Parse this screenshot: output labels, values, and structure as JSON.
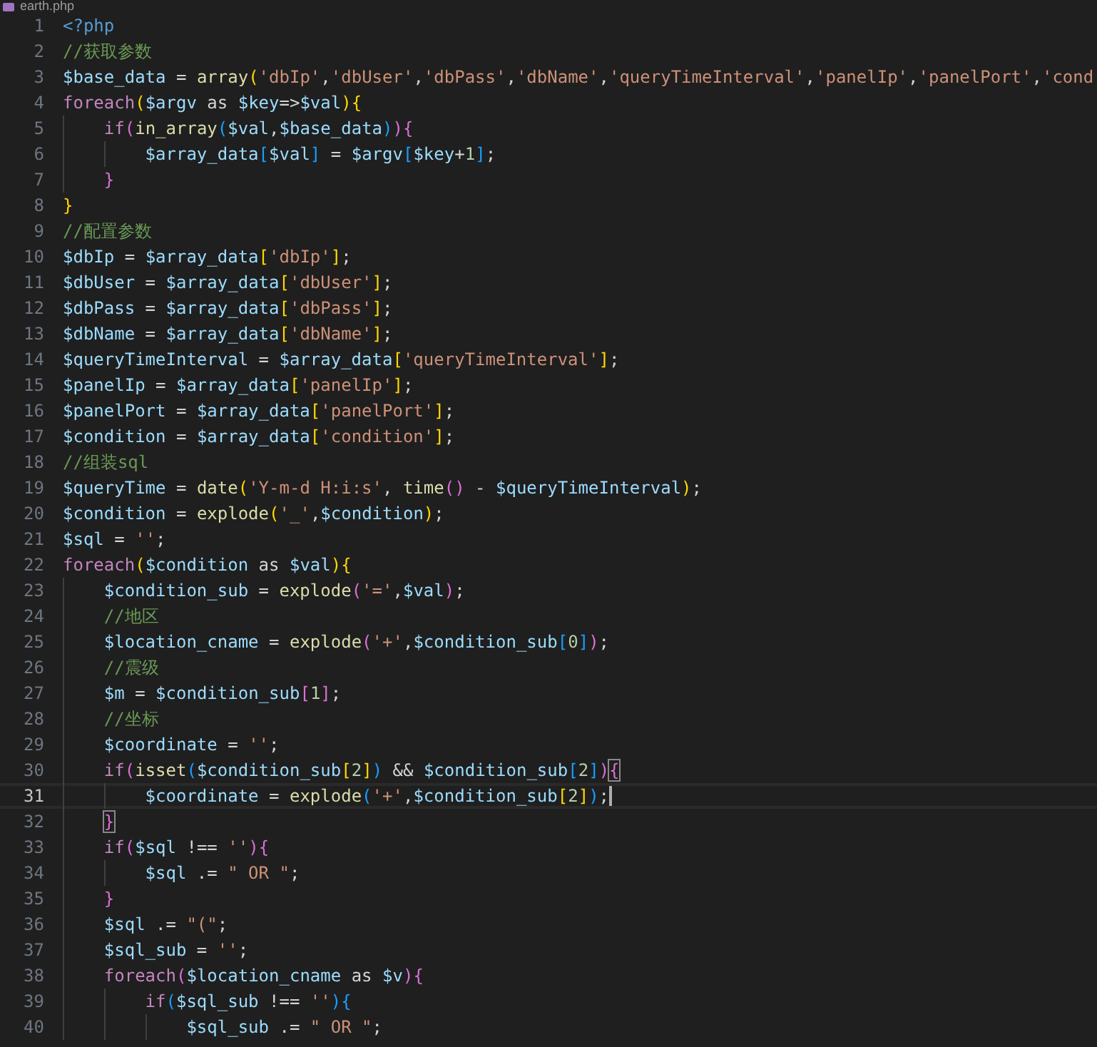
{
  "tab": {
    "title": "earth.php"
  },
  "lines": [
    {
      "number": "1",
      "current": false,
      "tokens": [
        {
          "kind": "tag",
          "text": "<?php"
        }
      ]
    },
    {
      "number": "2",
      "current": false,
      "tokens": [
        {
          "kind": "cm",
          "text": "//获取参数"
        }
      ]
    },
    {
      "number": "3",
      "current": false,
      "tokens": [
        {
          "kind": "var",
          "text": "$base_data"
        },
        {
          "kind": "op",
          "text": " = "
        },
        {
          "kind": "fn",
          "text": "array"
        },
        {
          "kind": "b1",
          "text": "("
        },
        {
          "kind": "str",
          "text": "'dbIp'"
        },
        {
          "kind": "op",
          "text": ","
        },
        {
          "kind": "str",
          "text": "'dbUser'"
        },
        {
          "kind": "op",
          "text": ","
        },
        {
          "kind": "str",
          "text": "'dbPass'"
        },
        {
          "kind": "op",
          "text": ","
        },
        {
          "kind": "str",
          "text": "'dbName'"
        },
        {
          "kind": "op",
          "text": ","
        },
        {
          "kind": "str",
          "text": "'queryTimeInterval'"
        },
        {
          "kind": "op",
          "text": ","
        },
        {
          "kind": "str",
          "text": "'panelIp'"
        },
        {
          "kind": "op",
          "text": ","
        },
        {
          "kind": "str",
          "text": "'panelPort'"
        },
        {
          "kind": "op",
          "text": ","
        },
        {
          "kind": "str",
          "text": "'cond"
        }
      ]
    },
    {
      "number": "4",
      "current": false,
      "tokens": [
        {
          "kind": "kw",
          "text": "foreach"
        },
        {
          "kind": "b1",
          "text": "("
        },
        {
          "kind": "var",
          "text": "$argv"
        },
        {
          "kind": "op",
          "text": " as "
        },
        {
          "kind": "var",
          "text": "$key"
        },
        {
          "kind": "op",
          "text": "=>"
        },
        {
          "kind": "var",
          "text": "$val"
        },
        {
          "kind": "b1",
          "text": ")"
        },
        {
          "kind": "b1",
          "text": "{"
        }
      ]
    },
    {
      "number": "5",
      "current": false,
      "tokens": [
        {
          "kind": "kw",
          "text": "    if"
        },
        {
          "kind": "b2",
          "text": "("
        },
        {
          "kind": "fn",
          "text": "in_array"
        },
        {
          "kind": "b3",
          "text": "("
        },
        {
          "kind": "var",
          "text": "$val"
        },
        {
          "kind": "op",
          "text": ","
        },
        {
          "kind": "var",
          "text": "$base_data"
        },
        {
          "kind": "b3",
          "text": ")"
        },
        {
          "kind": "b2",
          "text": ")"
        },
        {
          "kind": "b2",
          "text": "{"
        }
      ]
    },
    {
      "number": "6",
      "current": false,
      "tokens": [
        {
          "kind": "var",
          "text": "        $array_data"
        },
        {
          "kind": "b3",
          "text": "["
        },
        {
          "kind": "var",
          "text": "$val"
        },
        {
          "kind": "b3",
          "text": "]"
        },
        {
          "kind": "op",
          "text": " = "
        },
        {
          "kind": "var",
          "text": "$argv"
        },
        {
          "kind": "b3",
          "text": "["
        },
        {
          "kind": "var",
          "text": "$key"
        },
        {
          "kind": "op",
          "text": "+"
        },
        {
          "kind": "num",
          "text": "1"
        },
        {
          "kind": "b3",
          "text": "]"
        },
        {
          "kind": "op",
          "text": ";"
        }
      ]
    },
    {
      "number": "7",
      "current": false,
      "tokens": [
        {
          "kind": "b2",
          "text": "    }"
        }
      ]
    },
    {
      "number": "8",
      "current": false,
      "tokens": [
        {
          "kind": "b1",
          "text": "}"
        }
      ]
    },
    {
      "number": "9",
      "current": false,
      "tokens": [
        {
          "kind": "cm",
          "text": "//配置参数"
        }
      ]
    },
    {
      "number": "10",
      "current": false,
      "tokens": [
        {
          "kind": "var",
          "text": "$dbIp"
        },
        {
          "kind": "op",
          "text": " = "
        },
        {
          "kind": "var",
          "text": "$array_data"
        },
        {
          "kind": "b1",
          "text": "["
        },
        {
          "kind": "str",
          "text": "'dbIp'"
        },
        {
          "kind": "b1",
          "text": "]"
        },
        {
          "kind": "op",
          "text": ";"
        }
      ]
    },
    {
      "number": "11",
      "current": false,
      "tokens": [
        {
          "kind": "var",
          "text": "$dbUser"
        },
        {
          "kind": "op",
          "text": " = "
        },
        {
          "kind": "var",
          "text": "$array_data"
        },
        {
          "kind": "b1",
          "text": "["
        },
        {
          "kind": "str",
          "text": "'dbUser'"
        },
        {
          "kind": "b1",
          "text": "]"
        },
        {
          "kind": "op",
          "text": ";"
        }
      ]
    },
    {
      "number": "12",
      "current": false,
      "tokens": [
        {
          "kind": "var",
          "text": "$dbPass"
        },
        {
          "kind": "op",
          "text": " = "
        },
        {
          "kind": "var",
          "text": "$array_data"
        },
        {
          "kind": "b1",
          "text": "["
        },
        {
          "kind": "str",
          "text": "'dbPass'"
        },
        {
          "kind": "b1",
          "text": "]"
        },
        {
          "kind": "op",
          "text": ";"
        }
      ]
    },
    {
      "number": "13",
      "current": false,
      "tokens": [
        {
          "kind": "var",
          "text": "$dbName"
        },
        {
          "kind": "op",
          "text": " = "
        },
        {
          "kind": "var",
          "text": "$array_data"
        },
        {
          "kind": "b1",
          "text": "["
        },
        {
          "kind": "str",
          "text": "'dbName'"
        },
        {
          "kind": "b1",
          "text": "]"
        },
        {
          "kind": "op",
          "text": ";"
        }
      ]
    },
    {
      "number": "14",
      "current": false,
      "tokens": [
        {
          "kind": "var",
          "text": "$queryTimeInterval"
        },
        {
          "kind": "op",
          "text": " = "
        },
        {
          "kind": "var",
          "text": "$array_data"
        },
        {
          "kind": "b1",
          "text": "["
        },
        {
          "kind": "str",
          "text": "'queryTimeInterval'"
        },
        {
          "kind": "b1",
          "text": "]"
        },
        {
          "kind": "op",
          "text": ";"
        }
      ]
    },
    {
      "number": "15",
      "current": false,
      "tokens": [
        {
          "kind": "var",
          "text": "$panelIp"
        },
        {
          "kind": "op",
          "text": " = "
        },
        {
          "kind": "var",
          "text": "$array_data"
        },
        {
          "kind": "b1",
          "text": "["
        },
        {
          "kind": "str",
          "text": "'panelIp'"
        },
        {
          "kind": "b1",
          "text": "]"
        },
        {
          "kind": "op",
          "text": ";"
        }
      ]
    },
    {
      "number": "16",
      "current": false,
      "tokens": [
        {
          "kind": "var",
          "text": "$panelPort"
        },
        {
          "kind": "op",
          "text": " = "
        },
        {
          "kind": "var",
          "text": "$array_data"
        },
        {
          "kind": "b1",
          "text": "["
        },
        {
          "kind": "str",
          "text": "'panelPort'"
        },
        {
          "kind": "b1",
          "text": "]"
        },
        {
          "kind": "op",
          "text": ";"
        }
      ]
    },
    {
      "number": "17",
      "current": false,
      "tokens": [
        {
          "kind": "var",
          "text": "$condition"
        },
        {
          "kind": "op",
          "text": " = "
        },
        {
          "kind": "var",
          "text": "$array_data"
        },
        {
          "kind": "b1",
          "text": "["
        },
        {
          "kind": "str",
          "text": "'condition'"
        },
        {
          "kind": "b1",
          "text": "]"
        },
        {
          "kind": "op",
          "text": ";"
        }
      ]
    },
    {
      "number": "18",
      "current": false,
      "tokens": [
        {
          "kind": "cm",
          "text": "//组装sql"
        }
      ]
    },
    {
      "number": "19",
      "current": false,
      "tokens": [
        {
          "kind": "var",
          "text": "$queryTime"
        },
        {
          "kind": "op",
          "text": " = "
        },
        {
          "kind": "fn",
          "text": "date"
        },
        {
          "kind": "b1",
          "text": "("
        },
        {
          "kind": "str",
          "text": "'Y-m-d H:i:s'"
        },
        {
          "kind": "op",
          "text": ", "
        },
        {
          "kind": "fn",
          "text": "time"
        },
        {
          "kind": "b2",
          "text": "()"
        },
        {
          "kind": "op",
          "text": " - "
        },
        {
          "kind": "var",
          "text": "$queryTimeInterval"
        },
        {
          "kind": "b1",
          "text": ")"
        },
        {
          "kind": "op",
          "text": ";"
        }
      ]
    },
    {
      "number": "20",
      "current": false,
      "tokens": [
        {
          "kind": "var",
          "text": "$condition"
        },
        {
          "kind": "op",
          "text": " = "
        },
        {
          "kind": "fn",
          "text": "explode"
        },
        {
          "kind": "b1",
          "text": "("
        },
        {
          "kind": "str",
          "text": "'_'"
        },
        {
          "kind": "op",
          "text": ","
        },
        {
          "kind": "var",
          "text": "$condition"
        },
        {
          "kind": "b1",
          "text": ")"
        },
        {
          "kind": "op",
          "text": ";"
        }
      ]
    },
    {
      "number": "21",
      "current": false,
      "tokens": [
        {
          "kind": "var",
          "text": "$sql"
        },
        {
          "kind": "op",
          "text": " = "
        },
        {
          "kind": "str",
          "text": "''"
        },
        {
          "kind": "op",
          "text": ";"
        }
      ]
    },
    {
      "number": "22",
      "current": false,
      "tokens": [
        {
          "kind": "kw",
          "text": "foreach"
        },
        {
          "kind": "b1",
          "text": "("
        },
        {
          "kind": "var",
          "text": "$condition"
        },
        {
          "kind": "op",
          "text": " as "
        },
        {
          "kind": "var",
          "text": "$val"
        },
        {
          "kind": "b1",
          "text": ")"
        },
        {
          "kind": "b1",
          "text": "{"
        }
      ]
    },
    {
      "number": "23",
      "current": false,
      "tokens": [
        {
          "kind": "var",
          "text": "    $condition_sub"
        },
        {
          "kind": "op",
          "text": " = "
        },
        {
          "kind": "fn",
          "text": "explode"
        },
        {
          "kind": "b2",
          "text": "("
        },
        {
          "kind": "str",
          "text": "'='"
        },
        {
          "kind": "op",
          "text": ","
        },
        {
          "kind": "var",
          "text": "$val"
        },
        {
          "kind": "b2",
          "text": ")"
        },
        {
          "kind": "op",
          "text": ";"
        }
      ]
    },
    {
      "number": "24",
      "current": false,
      "tokens": [
        {
          "kind": "cm",
          "text": "    //地区"
        }
      ]
    },
    {
      "number": "25",
      "current": false,
      "tokens": [
        {
          "kind": "var",
          "text": "    $location_cname"
        },
        {
          "kind": "op",
          "text": " = "
        },
        {
          "kind": "fn",
          "text": "explode"
        },
        {
          "kind": "b2",
          "text": "("
        },
        {
          "kind": "str",
          "text": "'+'"
        },
        {
          "kind": "op",
          "text": ","
        },
        {
          "kind": "var",
          "text": "$condition_sub"
        },
        {
          "kind": "b3",
          "text": "["
        },
        {
          "kind": "num",
          "text": "0"
        },
        {
          "kind": "b3",
          "text": "]"
        },
        {
          "kind": "b2",
          "text": ")"
        },
        {
          "kind": "op",
          "text": ";"
        }
      ]
    },
    {
      "number": "26",
      "current": false,
      "tokens": [
        {
          "kind": "cm",
          "text": "    //震级"
        }
      ]
    },
    {
      "number": "27",
      "current": false,
      "tokens": [
        {
          "kind": "var",
          "text": "    $m"
        },
        {
          "kind": "op",
          "text": " = "
        },
        {
          "kind": "var",
          "text": "$condition_sub"
        },
        {
          "kind": "b2",
          "text": "["
        },
        {
          "kind": "num",
          "text": "1"
        },
        {
          "kind": "b2",
          "text": "]"
        },
        {
          "kind": "op",
          "text": ";"
        }
      ]
    },
    {
      "number": "28",
      "current": false,
      "tokens": [
        {
          "kind": "cm",
          "text": "    //坐标"
        }
      ]
    },
    {
      "number": "29",
      "current": false,
      "tokens": [
        {
          "kind": "var",
          "text": "    $coordinate"
        },
        {
          "kind": "op",
          "text": " = "
        },
        {
          "kind": "str",
          "text": "''"
        },
        {
          "kind": "op",
          "text": ";"
        }
      ]
    },
    {
      "number": "30",
      "current": false,
      "tokens": [
        {
          "kind": "kw",
          "text": "    if"
        },
        {
          "kind": "b2",
          "text": "("
        },
        {
          "kind": "fn",
          "text": "isset"
        },
        {
          "kind": "b3",
          "text": "("
        },
        {
          "kind": "var",
          "text": "$condition_sub"
        },
        {
          "kind": "b1",
          "text": "["
        },
        {
          "kind": "num",
          "text": "2"
        },
        {
          "kind": "b1",
          "text": "]"
        },
        {
          "kind": "b3",
          "text": ")"
        },
        {
          "kind": "op",
          "text": " && "
        },
        {
          "kind": "var",
          "text": "$condition_sub"
        },
        {
          "kind": "b3",
          "text": "["
        },
        {
          "kind": "num",
          "text": "2"
        },
        {
          "kind": "b3",
          "text": "]"
        },
        {
          "kind": "b2",
          "text": ")"
        },
        {
          "kind": "b2",
          "text": "{",
          "matched": true
        }
      ]
    },
    {
      "number": "31",
      "current": true,
      "tokens": [
        {
          "kind": "var",
          "text": "        $coordinate"
        },
        {
          "kind": "op",
          "text": " = "
        },
        {
          "kind": "fn",
          "text": "explode"
        },
        {
          "kind": "b3",
          "text": "("
        },
        {
          "kind": "str",
          "text": "'+'"
        },
        {
          "kind": "op",
          "text": ","
        },
        {
          "kind": "var",
          "text": "$condition_sub"
        },
        {
          "kind": "b1",
          "text": "["
        },
        {
          "kind": "num",
          "text": "2"
        },
        {
          "kind": "b1",
          "text": "]"
        },
        {
          "kind": "b3",
          "text": ")"
        },
        {
          "kind": "op",
          "text": ";"
        }
      ]
    },
    {
      "number": "32",
      "current": false,
      "tokens": [
        {
          "kind": "b2",
          "text": "    }",
          "matched": true
        }
      ]
    },
    {
      "number": "33",
      "current": false,
      "tokens": [
        {
          "kind": "kw",
          "text": "    if"
        },
        {
          "kind": "b2",
          "text": "("
        },
        {
          "kind": "var",
          "text": "$sql"
        },
        {
          "kind": "op",
          "text": " !== "
        },
        {
          "kind": "str",
          "text": "''"
        },
        {
          "kind": "b2",
          "text": ")"
        },
        {
          "kind": "b2",
          "text": "{"
        }
      ]
    },
    {
      "number": "34",
      "current": false,
      "tokens": [
        {
          "kind": "var",
          "text": "        $sql"
        },
        {
          "kind": "op",
          "text": " .= "
        },
        {
          "kind": "str",
          "text": "\" OR \""
        },
        {
          "kind": "op",
          "text": ";"
        }
      ]
    },
    {
      "number": "35",
      "current": false,
      "tokens": [
        {
          "kind": "b2",
          "text": "    }"
        }
      ]
    },
    {
      "number": "36",
      "current": false,
      "tokens": [
        {
          "kind": "var",
          "text": "    $sql"
        },
        {
          "kind": "op",
          "text": " .= "
        },
        {
          "kind": "str",
          "text": "\"(\""
        },
        {
          "kind": "op",
          "text": ";"
        }
      ]
    },
    {
      "number": "37",
      "current": false,
      "tokens": [
        {
          "kind": "var",
          "text": "    $sql_sub"
        },
        {
          "kind": "op",
          "text": " = "
        },
        {
          "kind": "str",
          "text": "''"
        },
        {
          "kind": "op",
          "text": ";"
        }
      ]
    },
    {
      "number": "38",
      "current": false,
      "tokens": [
        {
          "kind": "kw",
          "text": "    foreach"
        },
        {
          "kind": "b2",
          "text": "("
        },
        {
          "kind": "var",
          "text": "$location_cname"
        },
        {
          "kind": "op",
          "text": " as "
        },
        {
          "kind": "var",
          "text": "$v"
        },
        {
          "kind": "b2",
          "text": ")"
        },
        {
          "kind": "b2",
          "text": "{"
        }
      ]
    },
    {
      "number": "39",
      "current": false,
      "tokens": [
        {
          "kind": "kw",
          "text": "        if"
        },
        {
          "kind": "b3",
          "text": "("
        },
        {
          "kind": "var",
          "text": "$sql_sub"
        },
        {
          "kind": "op",
          "text": " !== "
        },
        {
          "kind": "str",
          "text": "''"
        },
        {
          "kind": "b3",
          "text": ")"
        },
        {
          "kind": "b3",
          "text": "{"
        }
      ]
    },
    {
      "number": "40",
      "current": false,
      "tokens": [
        {
          "kind": "var",
          "text": "            $sql_sub"
        },
        {
          "kind": "op",
          "text": " .= "
        },
        {
          "kind": "str",
          "text": "\" OR \""
        },
        {
          "kind": "op",
          "text": ";"
        }
      ]
    }
  ]
}
